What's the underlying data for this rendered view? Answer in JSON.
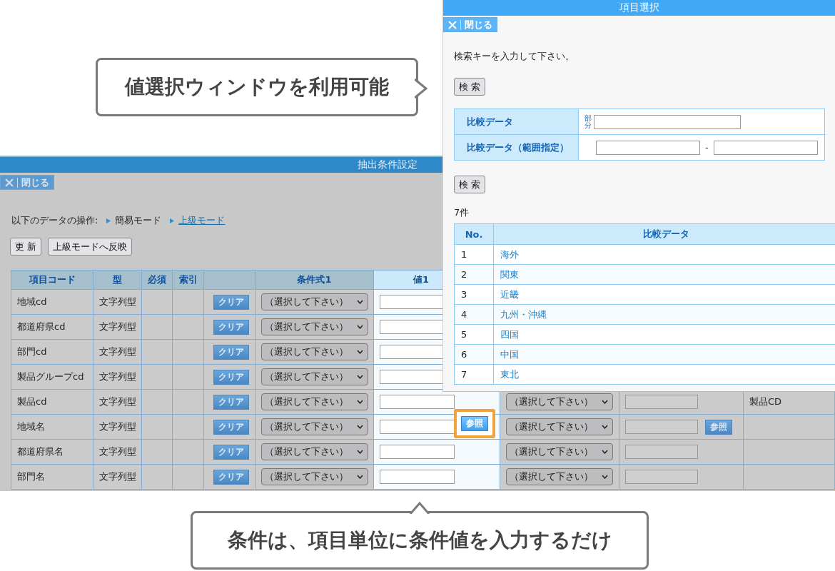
{
  "callout_top": {
    "text": "値選択ウィンドウを利用可能"
  },
  "callout_bottom": {
    "text": "条件は、項目単位に条件値を入力するだけ"
  },
  "main_window": {
    "title": "抽出条件設定",
    "close_label": "閉じる",
    "operation_label": "以下のデータの操作:",
    "modes": [
      {
        "label": "簡易モード",
        "selected": true
      },
      {
        "label": "上級モード",
        "selected": false
      }
    ],
    "buttons": [
      "更 新",
      "上級モードへ反映"
    ],
    "columns": {
      "item_code": "項目コード",
      "type": "型",
      "required": "必須",
      "index": "索引",
      "condition1": "条件式1",
      "value1": "値1"
    },
    "rows": [
      {
        "item_code": "地域cd",
        "type": "文字列型",
        "clear": "クリア",
        "condition1": "（選択して下さい）"
      },
      {
        "item_code": "都道府県cd",
        "type": "文字列型",
        "clear": "クリア",
        "condition1": "（選択して下さい）"
      },
      {
        "item_code": "部門cd",
        "type": "文字列型",
        "clear": "クリア",
        "condition1": "（選択して下さい）"
      },
      {
        "item_code": "製品グループcd",
        "type": "文字列型",
        "clear": "クリア",
        "condition1": "（選択して下さい）"
      },
      {
        "item_code": "製品cd",
        "type": "文字列型",
        "clear": "クリア",
        "condition1": "（選択して下さい）",
        "condition2": "（選択して下さい）",
        "column_10": "製品CD"
      },
      {
        "item_code": "地域名",
        "type": "文字列型",
        "clear": "クリア",
        "condition1": "（選択して下さい）",
        "reference_button": {
          "label": "参照",
          "highlighted": true
        },
        "condition2": "（選択して下さい）",
        "value2_reference": "参照"
      },
      {
        "item_code": "都道府県名",
        "type": "文字列型",
        "clear": "クリア",
        "condition1": "（選択して下さい）",
        "condition2": "（選択して下さい）"
      },
      {
        "item_code": "部門名",
        "type": "文字列型",
        "clear": "クリア",
        "condition1": "（選択して下さい）",
        "condition2": "（選択して下さい）"
      }
    ]
  },
  "popup": {
    "title": "項目選択",
    "close_label": "閉じる",
    "prompt": "検索キーを入力して下さい。",
    "search_buttons": [
      "検 索",
      "検 索"
    ],
    "form_rows": [
      {
        "kind": "partial",
        "label": "比較データ",
        "hint": "部分"
      },
      {
        "kind": "range",
        "label": "比較データ（範囲指定）",
        "separator": "-"
      }
    ],
    "count": "7件",
    "columns": [
      "No.",
      "比較データ"
    ],
    "results": [
      {
        "no": "1",
        "value": "海外"
      },
      {
        "no": "2",
        "value": "関東"
      },
      {
        "no": "3",
        "value": "近畿"
      },
      {
        "no": "4",
        "value": "九州・沖縄"
      },
      {
        "no": "5",
        "value": "四国"
      },
      {
        "no": "6",
        "value": "中国"
      },
      {
        "no": "7",
        "value": "東北"
      }
    ]
  }
}
